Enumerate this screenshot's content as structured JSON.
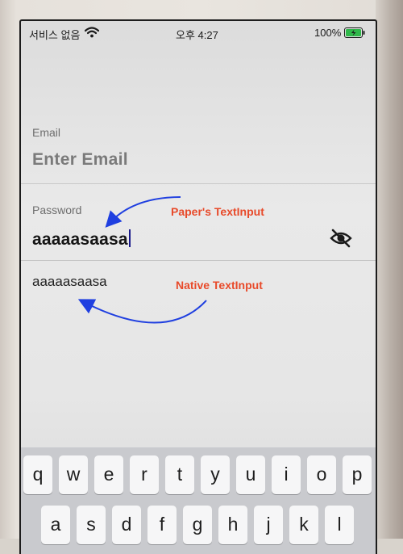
{
  "status_bar": {
    "carrier": "서비스 없음",
    "time": "오후 4:27",
    "battery": "100%",
    "wifi_icon": "wifi-icon",
    "battery_icon": "battery-charging-icon"
  },
  "form": {
    "email": {
      "label": "Email",
      "placeholder": "Enter Email"
    },
    "password": {
      "label": "Password",
      "value": "aaaaasaasa",
      "toggle_icon": "eye-off-icon"
    },
    "native_input": {
      "value": "aaaaasaasa"
    }
  },
  "annotations": {
    "paper_label": "Paper's TextInput",
    "native_label": "Native TextInput",
    "color": "#e84a2a",
    "arrow_color": "#1f3fe0"
  },
  "keyboard": {
    "rows": [
      [
        "q",
        "w",
        "e",
        "r",
        "t",
        "y",
        "u",
        "i",
        "o",
        "p"
      ],
      [
        "a",
        "s",
        "d",
        "f",
        "g",
        "h",
        "j",
        "k",
        "l"
      ]
    ]
  }
}
